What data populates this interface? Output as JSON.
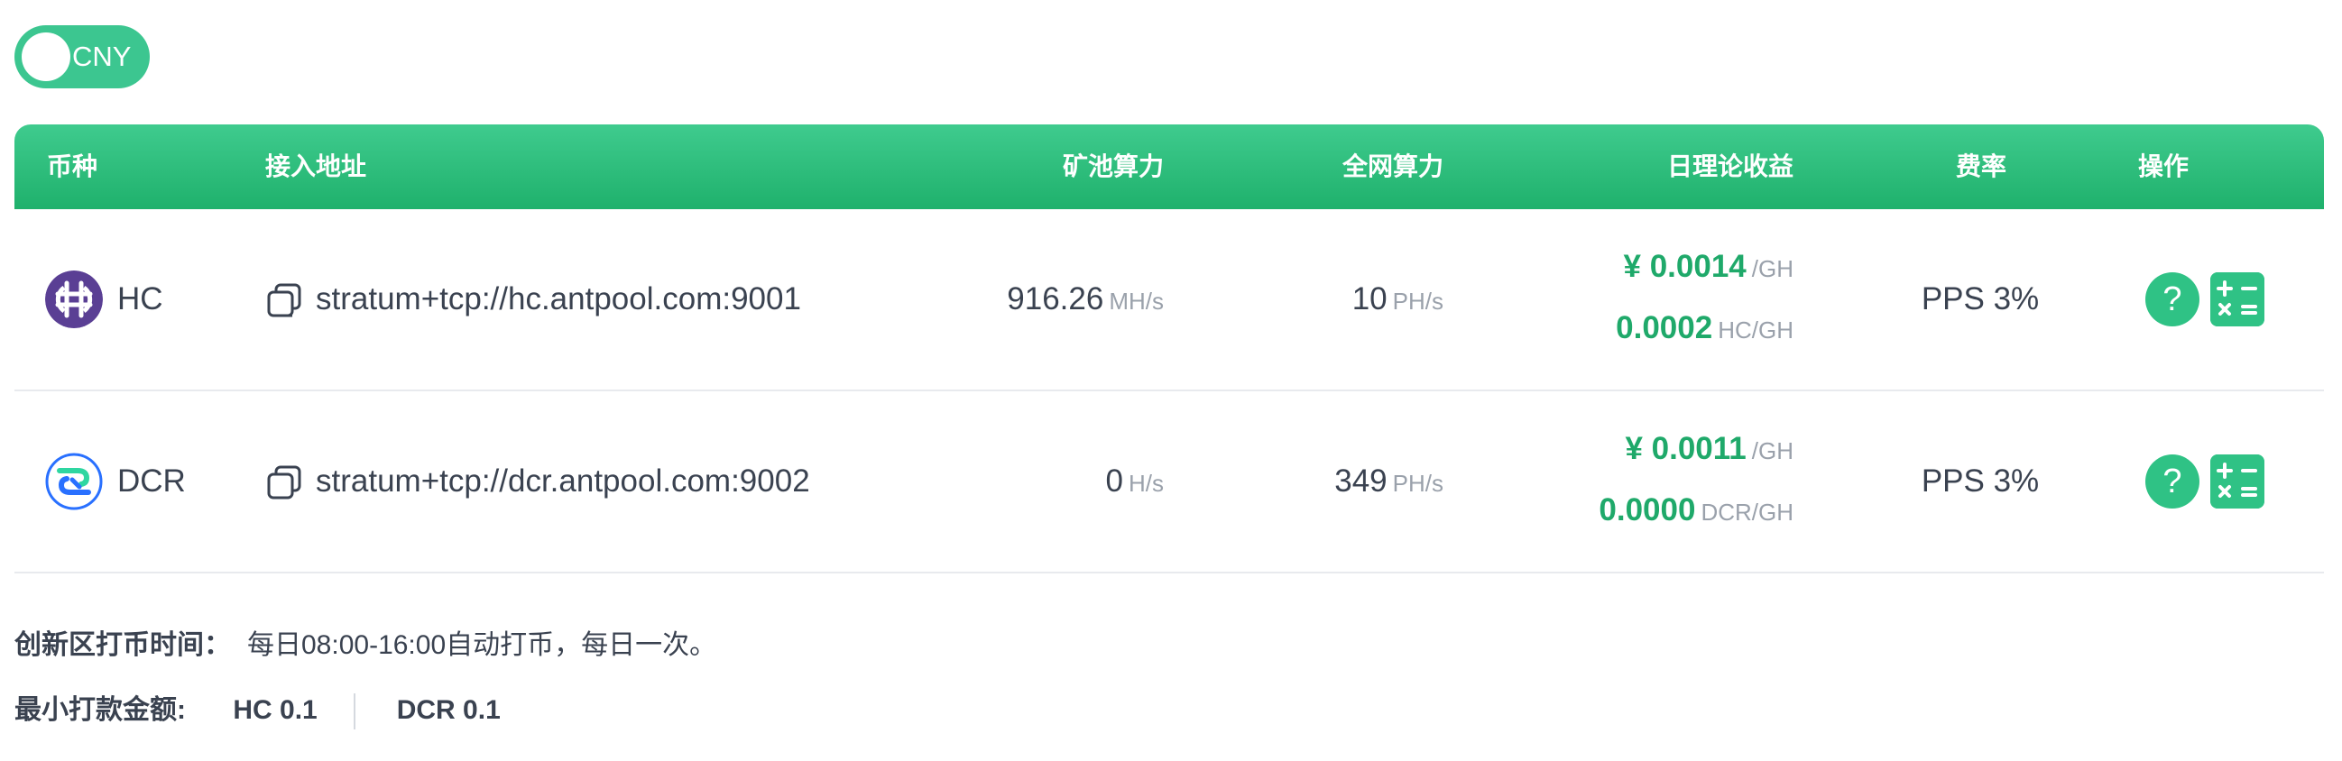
{
  "currency_toggle": {
    "label": "CNY"
  },
  "table": {
    "headers": {
      "coin": "币种",
      "address": "接入地址",
      "pool_hashrate": "矿池算力",
      "network_hashrate": "全网算力",
      "daily_income": "日理论收益",
      "fee": "费率",
      "action": "操作"
    },
    "rows": [
      {
        "coin": "HC",
        "logo_icon": "hc-coin-icon",
        "logo_color": "#5a3f94",
        "address": "stratum+tcp://hc.antpool.com:9001",
        "pool_hashrate_value": "916.26",
        "pool_hashrate_unit": "MH/s",
        "network_hashrate_value": "10",
        "network_hashrate_unit": "PH/s",
        "income_cny_value": "¥ 0.0014",
        "income_cny_unit": "/GH",
        "income_coin_value": "0.0002",
        "income_coin_unit": "HC/GH",
        "fee": "PPS 3%",
        "help_label": "?"
      },
      {
        "coin": "DCR",
        "logo_icon": "dcr-coin-icon",
        "logo_color": "#2970ff",
        "address": "stratum+tcp://dcr.antpool.com:9002",
        "pool_hashrate_value": "0",
        "pool_hashrate_unit": "H/s",
        "network_hashrate_value": "349",
        "network_hashrate_unit": "PH/s",
        "income_cny_value": "¥ 0.0011",
        "income_cny_unit": "/GH",
        "income_coin_value": "0.0000",
        "income_coin_unit": "DCR/GH",
        "fee": "PPS 3%",
        "help_label": "?"
      }
    ]
  },
  "notes": {
    "payout_label": "创新区打币时间：",
    "payout_text": "每日08:00-16:00自动打币，每日一次。",
    "min_label": "最小打款金额:",
    "min_hc": "HC 0.1",
    "min_dcr": "DCR 0.1"
  },
  "colors": {
    "accent": "#1fb16c",
    "income": "#1fa96a"
  }
}
